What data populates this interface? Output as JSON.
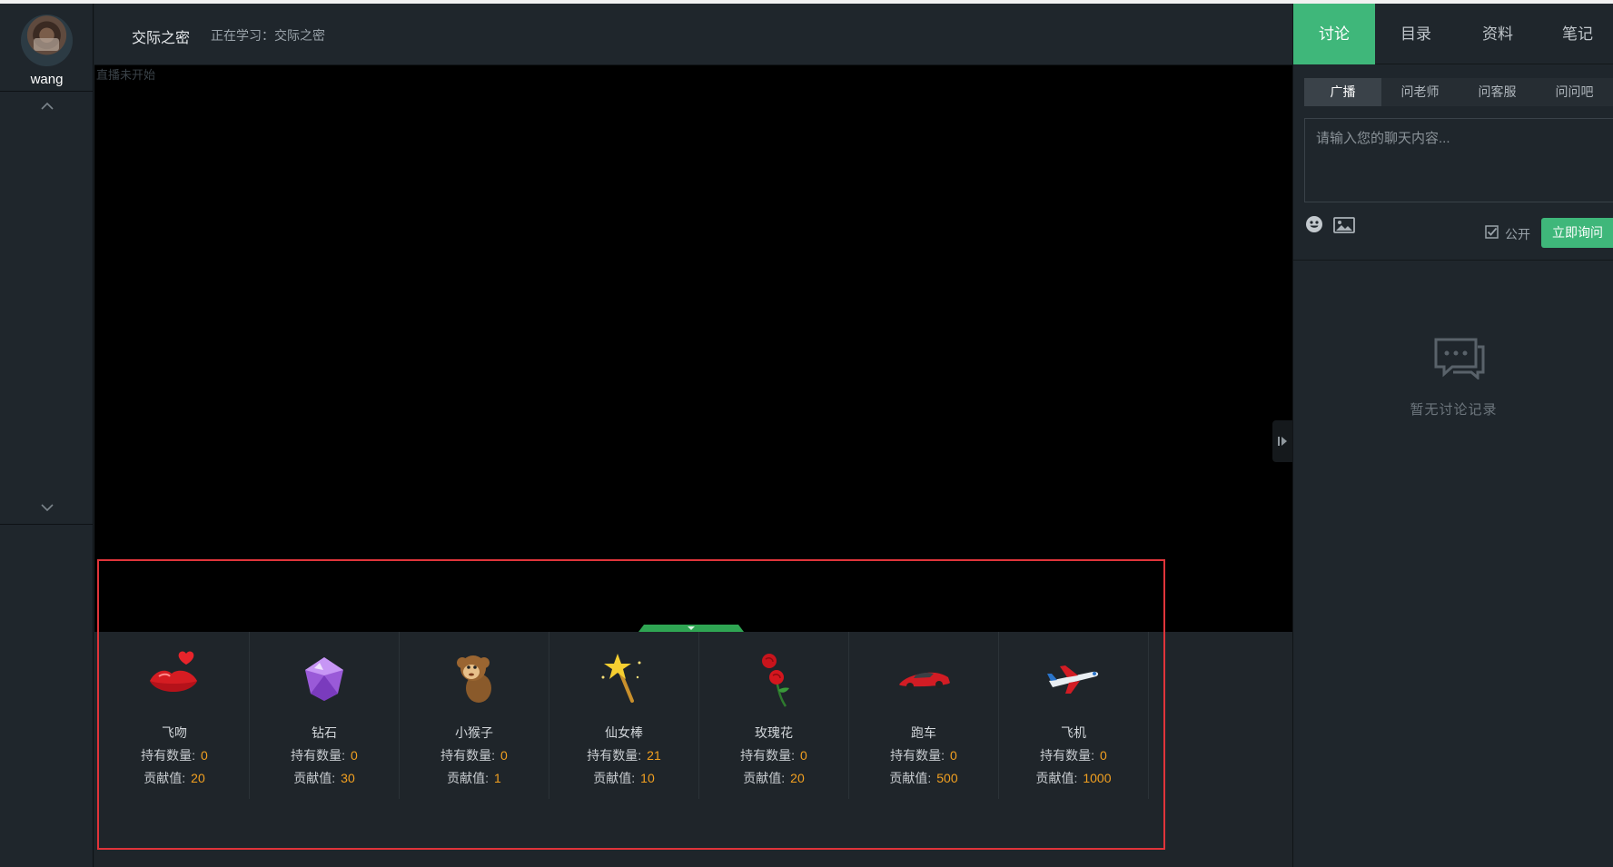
{
  "user": {
    "name": "wang"
  },
  "header": {
    "course_title": "交际之密",
    "learning_text": "正在学习：交际之密"
  },
  "video": {
    "status_text": "直播未开始"
  },
  "gifts": [
    {
      "icon": "kiss-lips-icon",
      "name": "飞吻",
      "own_label": "持有数量:",
      "own_value": "0",
      "contrib_label": "贡献值:",
      "contrib_value": "20"
    },
    {
      "icon": "diamond-icon",
      "name": "钻石",
      "own_label": "持有数量:",
      "own_value": "0",
      "contrib_label": "贡献值:",
      "contrib_value": "30"
    },
    {
      "icon": "monkey-icon",
      "name": "小猴子",
      "own_label": "持有数量:",
      "own_value": "0",
      "contrib_label": "贡献值:",
      "contrib_value": "1"
    },
    {
      "icon": "magic-wand-icon",
      "name": "仙女棒",
      "own_label": "持有数量:",
      "own_value": "21",
      "contrib_label": "贡献值:",
      "contrib_value": "10"
    },
    {
      "icon": "rose-icon",
      "name": "玫瑰花",
      "own_label": "持有数量:",
      "own_value": "0",
      "contrib_label": "贡献值:",
      "contrib_value": "20"
    },
    {
      "icon": "sports-car-icon",
      "name": "跑车",
      "own_label": "持有数量:",
      "own_value": "0",
      "contrib_label": "贡献值:",
      "contrib_value": "500"
    },
    {
      "icon": "airplane-icon",
      "name": "飞机",
      "own_label": "持有数量:",
      "own_value": "0",
      "contrib_label": "贡献值:",
      "contrib_value": "1000"
    }
  ],
  "right_panel": {
    "tabs": [
      "讨论",
      "目录",
      "资料",
      "笔记"
    ],
    "active_tab": "讨论",
    "subtabs": [
      "广播",
      "问老师",
      "问客服",
      "问问吧"
    ],
    "active_subtab": "广播",
    "chat_placeholder": "请输入您的聊天内容...",
    "public_label": "公开",
    "ask_button": "立即询问",
    "empty_text": "暂无讨论记录"
  },
  "colors": {
    "accent_green": "#3fb77a",
    "value_orange": "#f2a020",
    "highlight_red": "#e0343a",
    "background": "#1c2227"
  }
}
